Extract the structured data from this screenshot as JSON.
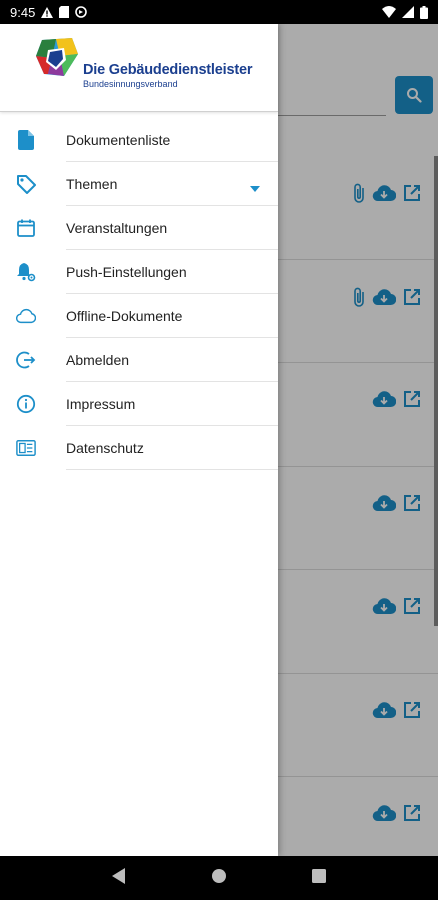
{
  "status_bar": {
    "time": "9:45"
  },
  "drawer": {
    "brand": {
      "name": "Die Gebäudedienstleister",
      "subtitle": "Bundesinnungsverband"
    },
    "items": [
      {
        "label": "Dokumentenliste",
        "icon": "document-icon"
      },
      {
        "label": "Themen",
        "icon": "tag-icon",
        "expandable": true
      },
      {
        "label": "Veranstaltungen",
        "icon": "calendar-icon"
      },
      {
        "label": "Push-Einstellungen",
        "icon": "bell-settings-icon"
      },
      {
        "label": "Offline-Dokumente",
        "icon": "cloud-icon"
      },
      {
        "label": "Abmelden",
        "icon": "logout-icon"
      },
      {
        "label": "Impressum",
        "icon": "info-icon"
      },
      {
        "label": "Datenschutz",
        "icon": "privacy-icon"
      }
    ]
  },
  "colors": {
    "accent": "#1d8fc9",
    "brand_text": "#1b3f8f"
  }
}
